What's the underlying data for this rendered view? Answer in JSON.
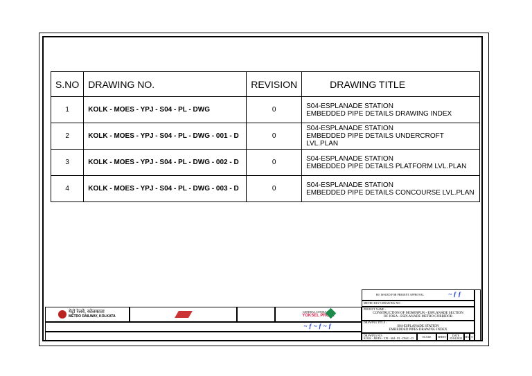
{
  "table": {
    "headers": [
      "S.NO",
      "DRAWING NO.",
      "REVISION",
      "DRAWING TITLE"
    ],
    "rows": [
      {
        "sno": "1",
        "dwg": "KOLK - MOES - YPJ - S04 - PL - DWG",
        "rev": "0",
        "title1": "S04-ESPLANADE STATION",
        "title2": "EMBEDDED PIPE DETAILS DRAWING INDEX"
      },
      {
        "sno": "2",
        "dwg": "KOLK - MOES - YPJ - S04 - PL - DWG - 001 - D",
        "rev": "0",
        "title1": "S04-ESPLANADE STATION",
        "title2": "EMBEDDED PIPE DETAILS UNDERCROFT LVL.PLAN"
      },
      {
        "sno": "3",
        "dwg": "KOLK - MOES - YPJ - S04 - PL - DWG - 002 - D",
        "rev": "0",
        "title1": "S04-ESPLANADE STATION",
        "title2": "EMBEDDED PIPE DETAILS PLATFORM LVL.PLAN"
      },
      {
        "sno": "4",
        "dwg": "KOLK - MOES - YPJ - S04 - PL - DWG - 003 - D",
        "rev": "0",
        "title1": "S04-ESPLANADE STATION",
        "title2": "EMBEDDED PIPE DETAILS CONCOURSE LVL.PLAN"
      }
    ]
  },
  "titleblock": {
    "client_hindi": "मेट्रो रेलवे, कोलकाता",
    "client": "METRO RAILWAY, KOLKATA",
    "consultant_label": "GENERAL CONSULTANT",
    "contractor": "YOKSEL PROJE",
    "rev_no": "R0",
    "rev_desc": "ISSUED FOR PRESENT APPROVAL",
    "metro_dwg_label": "METRO RLY'S DRAWING NO :",
    "project_label": "PROJECT NAME :",
    "project_line1": "CONSTRUCTION OF MOMINPUR - ESPLANADE SECTION",
    "project_line2": "OF JOKA - ESPLANADE METRO CORRIDOR",
    "title_label": "DRAWING TITLE :",
    "title_line1": "S04-ESPLANADE STATION",
    "title_line2": "EMBEDDED PIPES DRAWING INDEX",
    "dwg_label": "DRAWING NO :",
    "dwg_no": "KOLK - MOES - YPJ - S04 - PL - DWG - D",
    "scale_label": "SCALE",
    "sheet_label": "SHEET",
    "date_label": "DATE",
    "date": "25/04/2022",
    "rev_label": "REV",
    "rev": "0"
  }
}
